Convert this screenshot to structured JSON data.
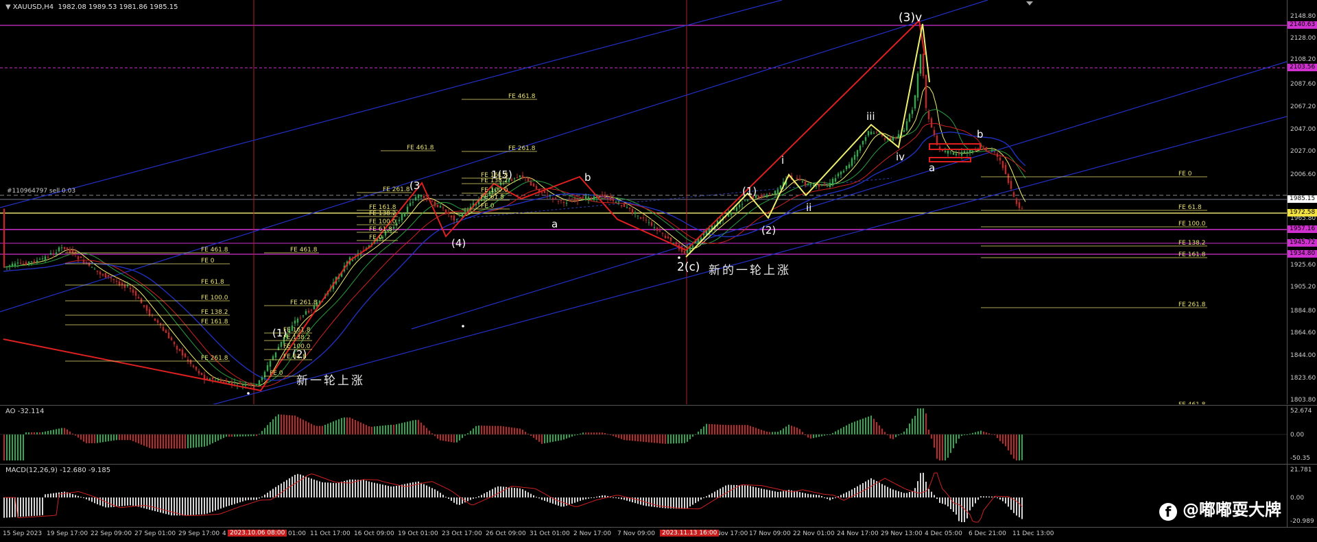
{
  "header": {
    "symbol": "XAUUSD,H4",
    "ohlc": "1982.08 1989.53 1981.86 1985.15"
  },
  "order_label": "#110964797 sell 0.03",
  "price_axis": {
    "ticks": [
      "2148.80",
      "2128.00",
      "2108.20",
      "2087.60",
      "2067.20",
      "2047.00",
      "2027.00",
      "2006.60",
      "1985.15",
      "1965.80",
      "1945.60",
      "1925.60",
      "1905.20",
      "1884.80",
      "1864.60",
      "1844.00",
      "1823.60",
      "1803.80"
    ],
    "tags": [
      {
        "label": "2140.63",
        "color": "#d030d0"
      },
      {
        "label": "2103.56",
        "color": "#d030d0"
      },
      {
        "label": "1985.15",
        "color": "#ffffff"
      },
      {
        "label": "1972.58",
        "color": "#f0e040"
      },
      {
        "label": "1957.16",
        "color": "#d030d0"
      },
      {
        "label": "1945.72",
        "color": "#d030d0"
      },
      {
        "label": "1934.80",
        "color": "#d030d0"
      }
    ]
  },
  "ao": {
    "label": "AO -32.114",
    "ticks": [
      "52.674",
      "0.00",
      "-50.35"
    ]
  },
  "macd": {
    "label": "MACD(12,26,9) -12.680 -9.185",
    "ticks": [
      "21.781",
      "0.00",
      "-20.989"
    ]
  },
  "time_axis": {
    "labels": [
      "15 Sep 2023",
      "19 Sep 17:00",
      "22 Sep 09:00",
      "27 Sep 01:00",
      "29 Sep 17:00",
      "4",
      "01:00",
      "11 Oct 17:00",
      "16 Oct 09:00",
      "19 Oct 01:00",
      "23 Oct 17:00",
      "26 Oct 09:00",
      "31 Oct 01:00",
      "2 Nov 17:00",
      "7 Nov 09:00",
      "Nov 17:00",
      "17 Nov 09:00",
      "22 Nov 01:00",
      "24 Nov 17:00",
      "29 Nov 13:00",
      "4 Dec 05:00",
      "6 Dec 21:00",
      "11 Dec 13:00"
    ],
    "highlights": [
      "2023.10.06 08:00",
      "2023.11.13 16:00"
    ]
  },
  "waves": {
    "w3v": "(3)v",
    "w3a": "(3",
    "w15": "1(5)",
    "wb1": "b",
    "wa1": "a",
    "w4": "(4)",
    "w1b": "(1)",
    "w2b": "(2)",
    "wi": "i",
    "wii": "ii",
    "wiii": "iii",
    "wiv": "iv",
    "wa2": "a",
    "wb2": "b",
    "w2c": "2(c)",
    "w1a": "(1)",
    "w2a": "(2)"
  },
  "annotations": {
    "cn_left": "新一轮上涨",
    "cn_right": "新的一轮上涨"
  },
  "fe_labels": [
    "FE 461.8",
    "FE 261.8",
    "FE 161.8",
    "FE 138.2",
    "FE 100.0",
    "FE 61.8",
    "FE 0",
    "FE 461.8",
    "FE 261.8",
    "FE 161.8",
    "FE 138.2",
    "FE 100.0",
    "FE 61.8",
    "FE 0",
    "FE 461.8",
    "FE 261.8",
    "FE 161.8",
    "FE 138.2",
    "FE 100.0",
    "FE 61.8",
    "FE 0",
    "FE 461.8",
    "FE 261.8",
    "FE 161.8",
    "FE 138.2",
    "FE 100.0",
    "FE 61.8",
    "FE 0",
    "FE 0",
    "FE 61.8",
    "FE 100.0",
    "FE 138.2",
    "FE 161.8",
    "FE 261.8",
    "FE 461.8"
  ],
  "watermark": "@嘟嘟耍大牌",
  "colors": {
    "bull": "#2fa84f",
    "bear": "#c0282a",
    "fe": "#e8e070",
    "magenta": "#d030d0",
    "wave_red": "#e02020",
    "wave_yellow": "#f0f070",
    "channel_blue": "#2230c8"
  }
}
